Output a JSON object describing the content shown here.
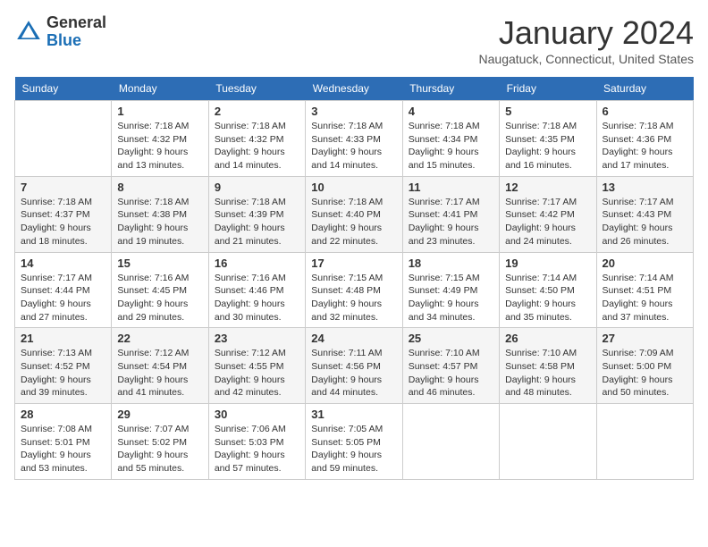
{
  "header": {
    "logo_general": "General",
    "logo_blue": "Blue",
    "month_title": "January 2024",
    "location": "Naugatuck, Connecticut, United States"
  },
  "weekdays": [
    "Sunday",
    "Monday",
    "Tuesday",
    "Wednesday",
    "Thursday",
    "Friday",
    "Saturday"
  ],
  "weeks": [
    [
      {
        "day": "",
        "sunrise": "",
        "sunset": "",
        "daylight": ""
      },
      {
        "day": "1",
        "sunrise": "Sunrise: 7:18 AM",
        "sunset": "Sunset: 4:32 PM",
        "daylight": "Daylight: 9 hours and 13 minutes."
      },
      {
        "day": "2",
        "sunrise": "Sunrise: 7:18 AM",
        "sunset": "Sunset: 4:32 PM",
        "daylight": "Daylight: 9 hours and 14 minutes."
      },
      {
        "day": "3",
        "sunrise": "Sunrise: 7:18 AM",
        "sunset": "Sunset: 4:33 PM",
        "daylight": "Daylight: 9 hours and 14 minutes."
      },
      {
        "day": "4",
        "sunrise": "Sunrise: 7:18 AM",
        "sunset": "Sunset: 4:34 PM",
        "daylight": "Daylight: 9 hours and 15 minutes."
      },
      {
        "day": "5",
        "sunrise": "Sunrise: 7:18 AM",
        "sunset": "Sunset: 4:35 PM",
        "daylight": "Daylight: 9 hours and 16 minutes."
      },
      {
        "day": "6",
        "sunrise": "Sunrise: 7:18 AM",
        "sunset": "Sunset: 4:36 PM",
        "daylight": "Daylight: 9 hours and 17 minutes."
      }
    ],
    [
      {
        "day": "7",
        "sunrise": "Sunrise: 7:18 AM",
        "sunset": "Sunset: 4:37 PM",
        "daylight": "Daylight: 9 hours and 18 minutes."
      },
      {
        "day": "8",
        "sunrise": "Sunrise: 7:18 AM",
        "sunset": "Sunset: 4:38 PM",
        "daylight": "Daylight: 9 hours and 19 minutes."
      },
      {
        "day": "9",
        "sunrise": "Sunrise: 7:18 AM",
        "sunset": "Sunset: 4:39 PM",
        "daylight": "Daylight: 9 hours and 21 minutes."
      },
      {
        "day": "10",
        "sunrise": "Sunrise: 7:18 AM",
        "sunset": "Sunset: 4:40 PM",
        "daylight": "Daylight: 9 hours and 22 minutes."
      },
      {
        "day": "11",
        "sunrise": "Sunrise: 7:17 AM",
        "sunset": "Sunset: 4:41 PM",
        "daylight": "Daylight: 9 hours and 23 minutes."
      },
      {
        "day": "12",
        "sunrise": "Sunrise: 7:17 AM",
        "sunset": "Sunset: 4:42 PM",
        "daylight": "Daylight: 9 hours and 24 minutes."
      },
      {
        "day": "13",
        "sunrise": "Sunrise: 7:17 AM",
        "sunset": "Sunset: 4:43 PM",
        "daylight": "Daylight: 9 hours and 26 minutes."
      }
    ],
    [
      {
        "day": "14",
        "sunrise": "Sunrise: 7:17 AM",
        "sunset": "Sunset: 4:44 PM",
        "daylight": "Daylight: 9 hours and 27 minutes."
      },
      {
        "day": "15",
        "sunrise": "Sunrise: 7:16 AM",
        "sunset": "Sunset: 4:45 PM",
        "daylight": "Daylight: 9 hours and 29 minutes."
      },
      {
        "day": "16",
        "sunrise": "Sunrise: 7:16 AM",
        "sunset": "Sunset: 4:46 PM",
        "daylight": "Daylight: 9 hours and 30 minutes."
      },
      {
        "day": "17",
        "sunrise": "Sunrise: 7:15 AM",
        "sunset": "Sunset: 4:48 PM",
        "daylight": "Daylight: 9 hours and 32 minutes."
      },
      {
        "day": "18",
        "sunrise": "Sunrise: 7:15 AM",
        "sunset": "Sunset: 4:49 PM",
        "daylight": "Daylight: 9 hours and 34 minutes."
      },
      {
        "day": "19",
        "sunrise": "Sunrise: 7:14 AM",
        "sunset": "Sunset: 4:50 PM",
        "daylight": "Daylight: 9 hours and 35 minutes."
      },
      {
        "day": "20",
        "sunrise": "Sunrise: 7:14 AM",
        "sunset": "Sunset: 4:51 PM",
        "daylight": "Daylight: 9 hours and 37 minutes."
      }
    ],
    [
      {
        "day": "21",
        "sunrise": "Sunrise: 7:13 AM",
        "sunset": "Sunset: 4:52 PM",
        "daylight": "Daylight: 9 hours and 39 minutes."
      },
      {
        "day": "22",
        "sunrise": "Sunrise: 7:12 AM",
        "sunset": "Sunset: 4:54 PM",
        "daylight": "Daylight: 9 hours and 41 minutes."
      },
      {
        "day": "23",
        "sunrise": "Sunrise: 7:12 AM",
        "sunset": "Sunset: 4:55 PM",
        "daylight": "Daylight: 9 hours and 42 minutes."
      },
      {
        "day": "24",
        "sunrise": "Sunrise: 7:11 AM",
        "sunset": "Sunset: 4:56 PM",
        "daylight": "Daylight: 9 hours and 44 minutes."
      },
      {
        "day": "25",
        "sunrise": "Sunrise: 7:10 AM",
        "sunset": "Sunset: 4:57 PM",
        "daylight": "Daylight: 9 hours and 46 minutes."
      },
      {
        "day": "26",
        "sunrise": "Sunrise: 7:10 AM",
        "sunset": "Sunset: 4:58 PM",
        "daylight": "Daylight: 9 hours and 48 minutes."
      },
      {
        "day": "27",
        "sunrise": "Sunrise: 7:09 AM",
        "sunset": "Sunset: 5:00 PM",
        "daylight": "Daylight: 9 hours and 50 minutes."
      }
    ],
    [
      {
        "day": "28",
        "sunrise": "Sunrise: 7:08 AM",
        "sunset": "Sunset: 5:01 PM",
        "daylight": "Daylight: 9 hours and 53 minutes."
      },
      {
        "day": "29",
        "sunrise": "Sunrise: 7:07 AM",
        "sunset": "Sunset: 5:02 PM",
        "daylight": "Daylight: 9 hours and 55 minutes."
      },
      {
        "day": "30",
        "sunrise": "Sunrise: 7:06 AM",
        "sunset": "Sunset: 5:03 PM",
        "daylight": "Daylight: 9 hours and 57 minutes."
      },
      {
        "day": "31",
        "sunrise": "Sunrise: 7:05 AM",
        "sunset": "Sunset: 5:05 PM",
        "daylight": "Daylight: 9 hours and 59 minutes."
      },
      {
        "day": "",
        "sunrise": "",
        "sunset": "",
        "daylight": ""
      },
      {
        "day": "",
        "sunrise": "",
        "sunset": "",
        "daylight": ""
      },
      {
        "day": "",
        "sunrise": "",
        "sunset": "",
        "daylight": ""
      }
    ]
  ]
}
